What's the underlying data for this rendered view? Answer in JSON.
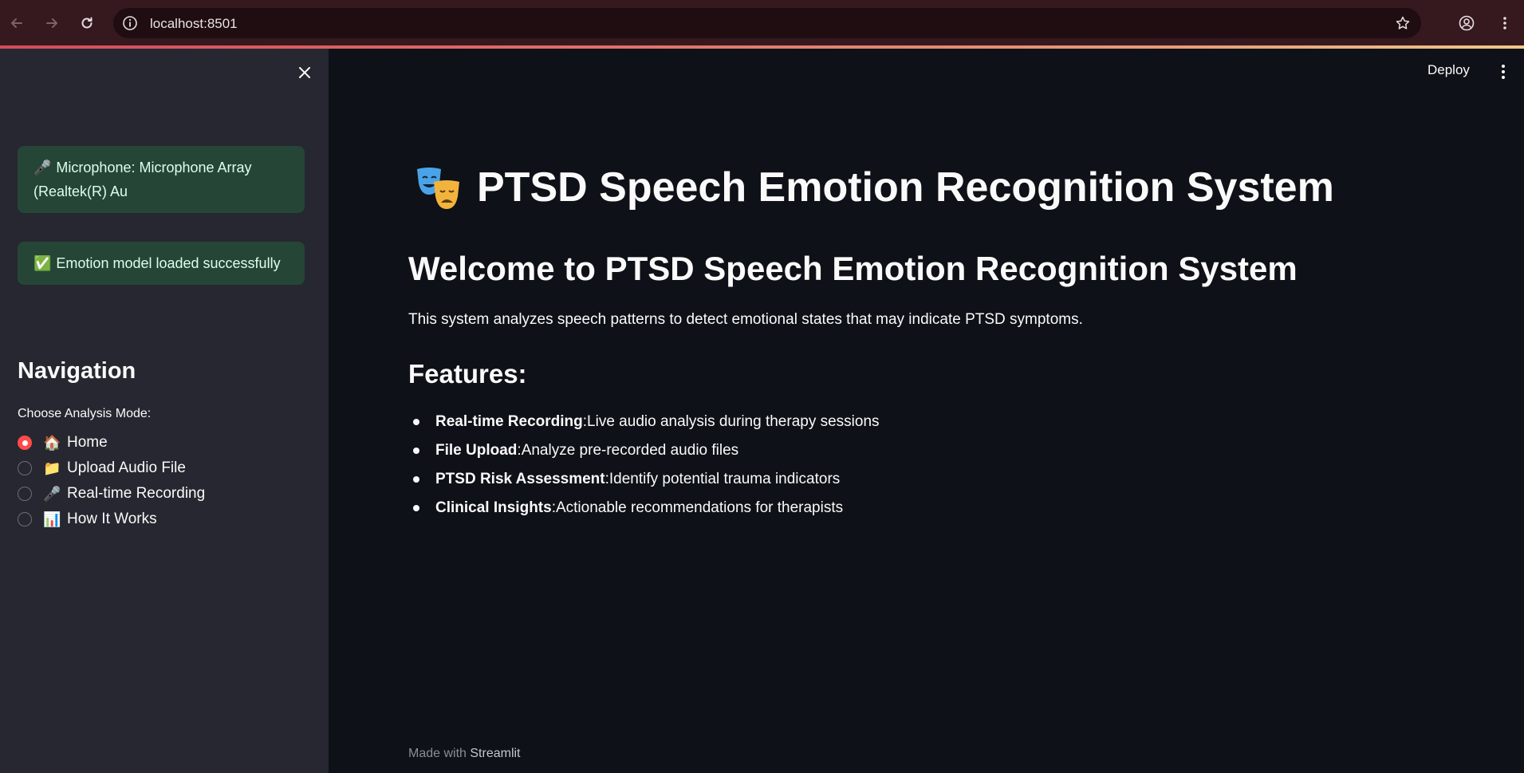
{
  "browser": {
    "url": "localhost:8501"
  },
  "sidebar": {
    "alerts": [
      {
        "icon": "🎤",
        "text": "Microphone: Microphone Array (Realtek(R) Au"
      },
      {
        "icon": "✅",
        "text": "Emotion model loaded successfully"
      }
    ],
    "nav_heading": "Navigation",
    "radio_label": "Choose Analysis Mode:",
    "options": [
      {
        "icon": "🏠",
        "label": "Home",
        "selected": true
      },
      {
        "icon": "📁",
        "label": "Upload Audio File",
        "selected": false
      },
      {
        "icon": "🎤",
        "label": "Real-time Recording",
        "selected": false
      },
      {
        "icon": "📊",
        "label": "How It Works",
        "selected": false
      }
    ]
  },
  "header": {
    "deploy_label": "Deploy"
  },
  "main": {
    "title_icon": "performing-arts-icon",
    "title": "PTSD Speech Emotion Recognition System",
    "welcome": "Welcome to PTSD Speech Emotion Recognition System",
    "description": "This system analyzes speech patterns to detect emotional states that may indicate PTSD symptoms.",
    "features_heading": "Features:",
    "features": [
      {
        "name": "Real-time Recording",
        "text": " Live audio analysis during therapy sessions"
      },
      {
        "name": "File Upload",
        "text": " Analyze pre-recorded audio files"
      },
      {
        "name": "PTSD Risk Assessment",
        "text": " Identify potential trauma indicators"
      },
      {
        "name": "Clinical Insights",
        "text": " Actionable recommendations for therapists"
      }
    ]
  },
  "footer": {
    "prefix": "Made with ",
    "brand": "Streamlit"
  },
  "colors": {
    "main_bg": "#0e1117",
    "sidebar_bg": "#262730",
    "chrome_bg": "#35191f",
    "success_bg": "#1e4a38",
    "radio_selected": "#ff4b4b"
  }
}
